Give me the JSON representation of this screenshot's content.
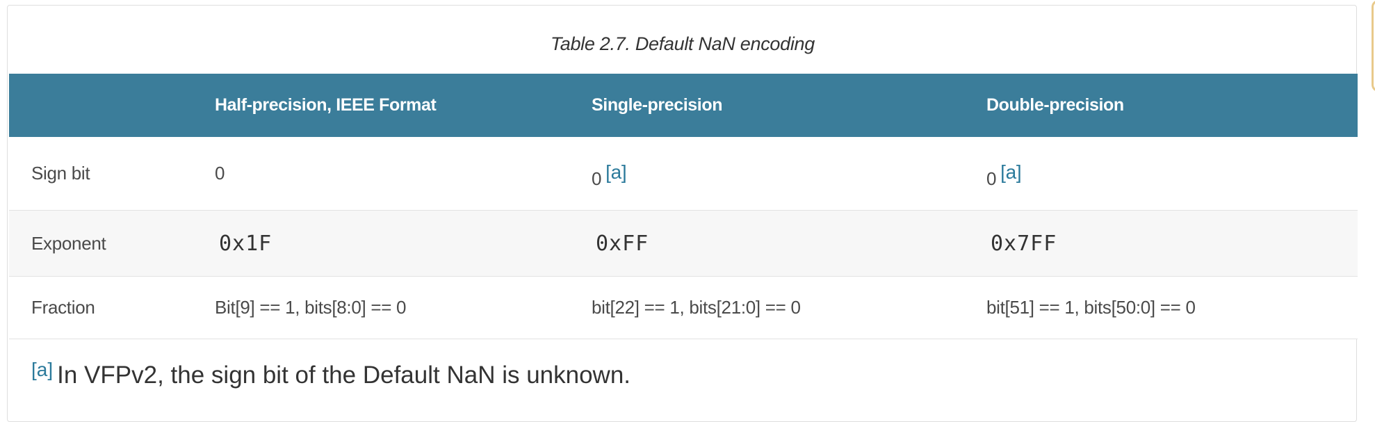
{
  "table": {
    "caption": "Table 2.7. Default NaN encoding",
    "headers": [
      "",
      "Half-precision, IEEE Format",
      "Single-precision",
      "Double-precision"
    ],
    "rows": [
      {
        "label": "Sign bit",
        "half": "0",
        "single": "0",
        "double": "0",
        "single_ref": "[a]",
        "double_ref": "[a]"
      },
      {
        "label": "Exponent",
        "half": "0x1F",
        "single": "0xFF",
        "double": "0x7FF"
      },
      {
        "label": "Fraction",
        "half": "Bit[9] == 1, bits[8:0] == 0",
        "single": "bit[22] == 1, bits[21:0] == 0",
        "double": "bit[51] == 1, bits[50:0] == 0"
      }
    ]
  },
  "footnote": {
    "marker": "[a]",
    "text": "In VFPv2, the sign bit of the Default NaN is unknown."
  },
  "colors": {
    "header_bg": "#3b7d9a",
    "link": "#2b7a9b",
    "stripe": "#f7f7f7"
  }
}
